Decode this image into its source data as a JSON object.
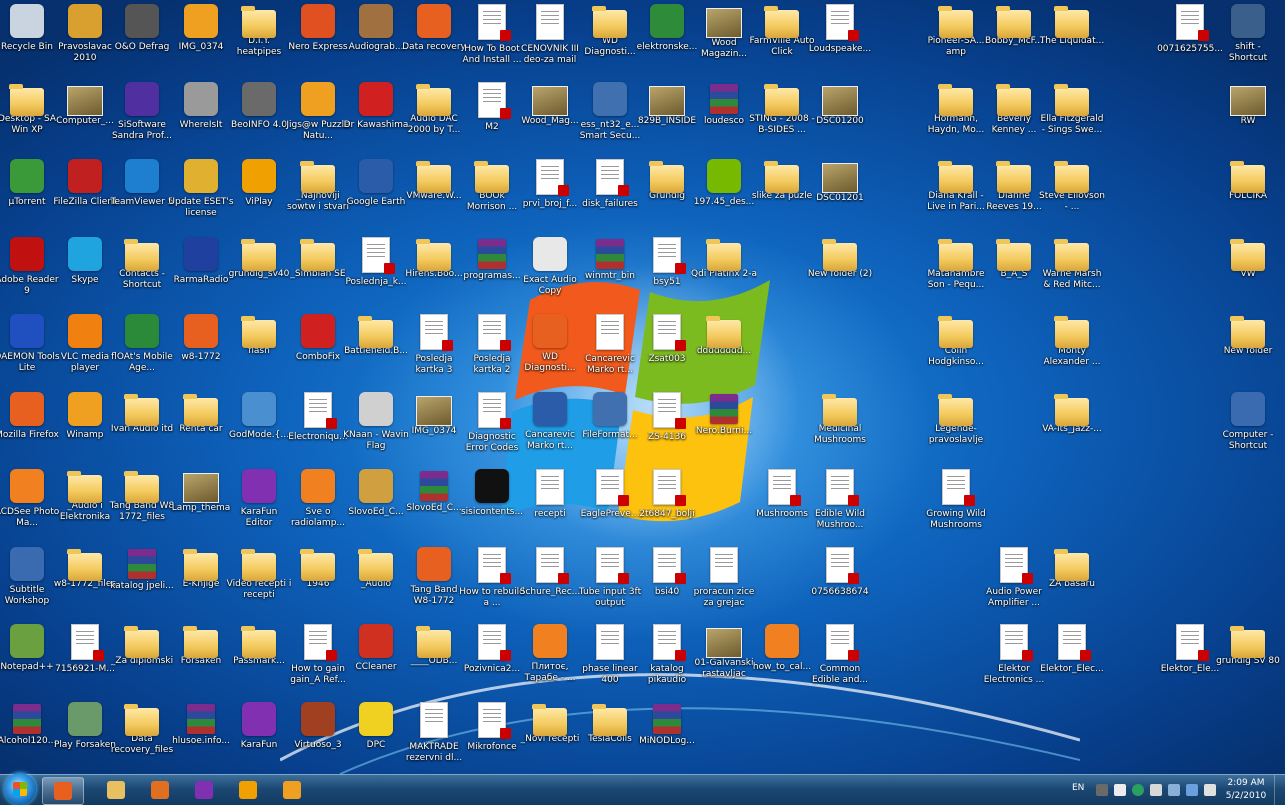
{
  "desktop": {
    "wallpaper": "windows-7-default",
    "icons": [
      {
        "label": "Recycle Bin",
        "type": "app",
        "icon": "recycle-bin-icon",
        "color": "#c9d4e0"
      },
      {
        "label": "Pravoslavac 2010",
        "type": "app",
        "icon": "cross-icon",
        "color": "#d9a030"
      },
      {
        "label": "O&O Defrag",
        "type": "app",
        "icon": "defrag-icon",
        "color": "#555555"
      },
      {
        "label": "IMG_0374",
        "type": "app",
        "icon": "image-icon",
        "color": "#f0a020"
      },
      {
        "label": "D.I.Y. heatpipes",
        "type": "folder"
      },
      {
        "label": "Nero Express",
        "type": "app",
        "icon": "nero-icon",
        "color": "#e05020"
      },
      {
        "label": "Audiograb...",
        "type": "app",
        "icon": "audiograbber-icon",
        "color": "#a07040"
      },
      {
        "label": "Data recovery",
        "type": "app",
        "icon": "firefox-document-icon",
        "color": "#e86020"
      },
      {
        "label": "How To Boot And Install ...",
        "type": "pdf"
      },
      {
        "label": "CENOVNIK III deo-za mail",
        "type": "doc"
      },
      {
        "label": "WD Diagnosti...",
        "type": "folder"
      },
      {
        "label": "elektronske...",
        "type": "app",
        "icon": "excel-icon",
        "color": "#2e8b3a"
      },
      {
        "label": "Wood Magazin...",
        "type": "image"
      },
      {
        "label": "FarmVille Auto Click",
        "type": "folder"
      },
      {
        "label": "Loudspeake...",
        "type": "pdf"
      },
      {
        "label": "Pioneer-SA... amp",
        "type": "folder"
      },
      {
        "label": "Bobby_McF...",
        "type": "folder"
      },
      {
        "label": "The Liquidat...",
        "type": "folder"
      },
      {
        "label": "0071625755...",
        "type": "pdf"
      },
      {
        "label": "shift - Shortcut",
        "type": "app",
        "icon": "shortcut-icon",
        "color": "#3a5f8a"
      },
      {
        "label": "Desktop - SA Win XP",
        "type": "folder"
      },
      {
        "label": "Computer_...",
        "type": "image"
      },
      {
        "label": "SiSoftware Sandra Prof...",
        "type": "app",
        "icon": "sisoftware-icon",
        "color": "#5030a0"
      },
      {
        "label": "WhereIsIt",
        "type": "app",
        "icon": "disc-icon",
        "color": "#9a9a9a"
      },
      {
        "label": "BeoINFO 4.0",
        "type": "app",
        "icon": "magnifier-icon",
        "color": "#6a6a6a"
      },
      {
        "label": "Jigs@w Puzzle Natu...",
        "type": "app",
        "icon": "puzzle-icon",
        "color": "#f0a020"
      },
      {
        "label": "Dr Kawashima",
        "type": "app",
        "icon": "robot-icon",
        "color": "#d02020"
      },
      {
        "label": "Audio DAC 2000 by T...",
        "type": "folder"
      },
      {
        "label": "M2",
        "type": "pdf"
      },
      {
        "label": "Wood_Mag...",
        "type": "image"
      },
      {
        "label": "ess_nt32_e... Smart Secu...",
        "type": "app",
        "icon": "installer-icon",
        "color": "#4070b0"
      },
      {
        "label": "829B_INSIDE",
        "type": "image"
      },
      {
        "label": "loudesco",
        "type": "rar"
      },
      {
        "label": "STING - 2008 - B-SIDES ...",
        "type": "folder"
      },
      {
        "label": "DSC01200",
        "type": "image"
      },
      {
        "label": "Hofmann, Haydn, Mo...",
        "type": "folder"
      },
      {
        "label": "Beverly Kenney ...",
        "type": "folder"
      },
      {
        "label": "Ella Fitzgerald - Sings Swe...",
        "type": "folder"
      },
      {
        "label": "RW",
        "type": "image"
      },
      {
        "label": "µTorrent",
        "type": "app",
        "icon": "utorrent-icon",
        "color": "#3a9a3a"
      },
      {
        "label": "FileZilla Client",
        "type": "app",
        "icon": "filezilla-icon",
        "color": "#c02020"
      },
      {
        "label": "TeamViewer 5",
        "type": "app",
        "icon": "teamviewer-icon",
        "color": "#1e7fd0"
      },
      {
        "label": "Update ESET's license",
        "type": "app",
        "icon": "update-icon",
        "color": "#e0b030"
      },
      {
        "label": "ViPlay",
        "type": "app",
        "icon": "viplay-icon",
        "color": "#f0a000"
      },
      {
        "label": "_Najnoviji sowtw i stvari",
        "type": "folder"
      },
      {
        "label": "Google Earth",
        "type": "app",
        "icon": "google-earth-icon",
        "color": "#2a5caa"
      },
      {
        "label": "VMware.W...",
        "type": "folder"
      },
      {
        "label": "BOOk Morrison ...",
        "type": "folder"
      },
      {
        "label": "prvi_broj_f...",
        "type": "pdf"
      },
      {
        "label": "disk_failures",
        "type": "pdf"
      },
      {
        "label": "Grundig",
        "type": "folder"
      },
      {
        "label": "197.45_des...",
        "type": "app",
        "icon": "nvidia-icon",
        "color": "#76b900"
      },
      {
        "label": "slike za puzle",
        "type": "folder"
      },
      {
        "label": "DSC01201",
        "type": "image"
      },
      {
        "label": "Diana Krall - Live in Pari...",
        "type": "folder"
      },
      {
        "label": "Dianne Reeves 19...",
        "type": "folder"
      },
      {
        "label": "Steve Eliovson - ...",
        "type": "folder"
      },
      {
        "label": "FOLCIKA",
        "type": "folder"
      },
      {
        "label": "Adobe Reader 9",
        "type": "app",
        "icon": "adobe-reader-icon",
        "color": "#c01010"
      },
      {
        "label": "Skype",
        "type": "app",
        "icon": "skype-icon",
        "color": "#1fa4e0"
      },
      {
        "label": "Contacts - Shortcut",
        "type": "folder"
      },
      {
        "label": "RarmaRadio",
        "type": "app",
        "icon": "radio-icon",
        "color": "#2040a0"
      },
      {
        "label": "grundig_sv40",
        "type": "folder"
      },
      {
        "label": "_Simbian SE",
        "type": "folder"
      },
      {
        "label": "Poslednja_k...",
        "type": "pdf"
      },
      {
        "label": "Hirens.Boo...",
        "type": "folder"
      },
      {
        "label": "programas...",
        "type": "rar"
      },
      {
        "label": "Exact Audio Copy",
        "type": "app",
        "icon": "eac-icon",
        "color": "#e8e8e8"
      },
      {
        "label": "winmtr_bin",
        "type": "rar"
      },
      {
        "label": "bsy51",
        "type": "pdf"
      },
      {
        "label": "Qdi Platinx 2-a",
        "type": "folder"
      },
      {
        "label": "New folder (2)",
        "type": "folder"
      },
      {
        "label": "Matahambre Son - Pequ...",
        "type": "folder"
      },
      {
        "label": "B_A_S",
        "type": "folder"
      },
      {
        "label": "Warne Marsh & Red Mitc...",
        "type": "folder"
      },
      {
        "label": "VW",
        "type": "folder"
      },
      {
        "label": "DAEMON Tools Lite",
        "type": "app",
        "icon": "daemon-icon",
        "color": "#2050c0"
      },
      {
        "label": "VLC media player",
        "type": "app",
        "icon": "vlc-icon",
        "color": "#f08010"
      },
      {
        "label": "flOAt's Mobile Age...",
        "type": "app",
        "icon": "mobile-agent-icon",
        "color": "#2a8a3a"
      },
      {
        "label": "w8-1772",
        "type": "app",
        "icon": "firefox-document-icon",
        "color": "#e86020"
      },
      {
        "label": "flash",
        "type": "folder"
      },
      {
        "label": "ComboFix",
        "type": "app",
        "icon": "combofix-icon",
        "color": "#d02020"
      },
      {
        "label": "Battlefield.B...",
        "type": "folder"
      },
      {
        "label": "Posledja kartka 3",
        "type": "pdf"
      },
      {
        "label": "Posledja kartka 2",
        "type": "pdf"
      },
      {
        "label": "WD Diagnosti...",
        "type": "app",
        "icon": "firefox-document-icon",
        "color": "#e86020"
      },
      {
        "label": "Cancarevic Marko rt...",
        "type": "doc"
      },
      {
        "label": "Zsat003",
        "type": "pdf"
      },
      {
        "label": "dddddddd...",
        "type": "folder"
      },
      {
        "label": "Colin Hodgkinso...",
        "type": "folder"
      },
      {
        "label": "Monty Alexander ...",
        "type": "folder"
      },
      {
        "label": "New folder",
        "type": "folder"
      },
      {
        "label": "Mozilla Firefox",
        "type": "app",
        "icon": "firefox-icon",
        "color": "#e86020"
      },
      {
        "label": "Winamp",
        "type": "app",
        "icon": "winamp-icon",
        "color": "#f0a020"
      },
      {
        "label": "Ivan Audio itd",
        "type": "folder"
      },
      {
        "label": "Renta car",
        "type": "folder"
      },
      {
        "label": "GodMode.{...",
        "type": "app",
        "icon": "control-panel-icon",
        "color": "#4a90d0"
      },
      {
        "label": "Electroniqu...",
        "type": "pdf"
      },
      {
        "label": "KNaan - Wavin Flag",
        "type": "app",
        "icon": "music-file-icon",
        "color": "#d0d0d0"
      },
      {
        "label": "IMG_0374",
        "type": "image"
      },
      {
        "label": "Diagnostic Error Codes",
        "type": "pdf"
      },
      {
        "label": "Cancarevic Marko rt...",
        "type": "app",
        "icon": "word-icon",
        "color": "#2a5caa"
      },
      {
        "label": "FileFormat...",
        "type": "app",
        "icon": "installer-icon",
        "color": "#4070b0"
      },
      {
        "label": "ZS-4136",
        "type": "pdf"
      },
      {
        "label": "Nero.Burni...",
        "type": "rar"
      },
      {
        "label": "Medicinal Mushrooms",
        "type": "folder"
      },
      {
        "label": "Legende-pravoslavlje",
        "type": "folder"
      },
      {
        "label": "VA-Its_Jazz-...",
        "type": "folder"
      },
      {
        "label": "Computer - Shortcut",
        "type": "app",
        "icon": "computer-icon",
        "color": "#3a6ab0"
      },
      {
        "label": "ACDSee Photo Ma...",
        "type": "app",
        "icon": "acdsee-icon",
        "color": "#f08020"
      },
      {
        "label": "_Audio i Elektronika",
        "type": "folder"
      },
      {
        "label": "Tang Band W8 1772_files",
        "type": "folder"
      },
      {
        "label": "Lamp_thema",
        "type": "image"
      },
      {
        "label": "KaraFun Editor",
        "type": "app",
        "icon": "karafun-icon",
        "color": "#8030b0"
      },
      {
        "label": "Sve o radiolamp...",
        "type": "app",
        "icon": "djvu-icon",
        "color": "#f08020"
      },
      {
        "label": "SlovoEd_C...",
        "type": "app",
        "icon": "slovoed-icon",
        "color": "#d0a040"
      },
      {
        "label": "SlovoEd_C...",
        "type": "rar"
      },
      {
        "label": "sisicontents...",
        "type": "app",
        "icon": "7zip-icon",
        "color": "#111111"
      },
      {
        "label": "recepti",
        "type": "doc"
      },
      {
        "label": "EaglePreve...",
        "type": "pdf"
      },
      {
        "label": "2t6847_bolji",
        "type": "pdf"
      },
      {
        "label": "Mushrooms",
        "type": "pdf"
      },
      {
        "label": "Edible Wild Mushroo...",
        "type": "pdf"
      },
      {
        "label": "Growing Wild Mushrooms",
        "type": "pdf"
      },
      {
        "label": "Subtitle Workshop",
        "type": "app",
        "icon": "subtitle-icon",
        "color": "#3a6ab0"
      },
      {
        "label": "w8-1772_files",
        "type": "folder"
      },
      {
        "label": "katalog jpeli...",
        "type": "rar"
      },
      {
        "label": "E-Knjige",
        "type": "folder"
      },
      {
        "label": "Video recepti i recepti",
        "type": "folder"
      },
      {
        "label": "1946",
        "type": "folder"
      },
      {
        "label": "_Audio",
        "type": "folder"
      },
      {
        "label": "Tang Band W8-1772",
        "type": "app",
        "icon": "firefox-document-icon",
        "color": "#e86020"
      },
      {
        "label": "How to rebuild a ...",
        "type": "pdf"
      },
      {
        "label": "Schure_Rec...",
        "type": "pdf"
      },
      {
        "label": "Tube input 3ft output",
        "type": "pdf"
      },
      {
        "label": "bsi40",
        "type": "pdf"
      },
      {
        "label": "proracun zice za grejac",
        "type": "doc"
      },
      {
        "label": "0756638674",
        "type": "pdf"
      },
      {
        "label": "Audio Power Amplifier ...",
        "type": "pdf"
      },
      {
        "label": "ZA basaru",
        "type": "folder"
      },
      {
        "label": "Notepad++",
        "type": "app",
        "icon": "notepad-plus-icon",
        "color": "#6aa040"
      },
      {
        "label": "7156921-M...",
        "type": "pdf"
      },
      {
        "label": "_Za diplomski",
        "type": "folder"
      },
      {
        "label": "Forsaken",
        "type": "folder"
      },
      {
        "label": "Passmark...",
        "type": "folder"
      },
      {
        "label": "How to gain gain_A Ref...",
        "type": "pdf"
      },
      {
        "label": "CCleaner",
        "type": "app",
        "icon": "ccleaner-icon",
        "color": "#d03020"
      },
      {
        "label": "____ODB...",
        "type": "folder"
      },
      {
        "label": "Pozivnica2...",
        "type": "pdf"
      },
      {
        "label": "Плитоє, Тарабе - ...",
        "type": "app",
        "icon": "djvu-icon",
        "color": "#f08020"
      },
      {
        "label": "phase linear 400",
        "type": "doc"
      },
      {
        "label": "katalog pikaudio",
        "type": "pdf"
      },
      {
        "label": "01-Galvanski rastavljac",
        "type": "image"
      },
      {
        "label": "how_to_cal...",
        "type": "app",
        "icon": "djvu-icon",
        "color": "#f08020"
      },
      {
        "label": "Common Edible and...",
        "type": "pdf"
      },
      {
        "label": "Elektor Electronics ...",
        "type": "pdf"
      },
      {
        "label": "Elektor_Elec...",
        "type": "pdf"
      },
      {
        "label": "Elektor_Ele...",
        "type": "pdf"
      },
      {
        "label": "grundig SV 80",
        "type": "folder"
      },
      {
        "label": "Alcohol120...",
        "type": "rar"
      },
      {
        "label": "Play Forsaken",
        "type": "app",
        "icon": "forsaken-icon",
        "color": "#6a9a6a"
      },
      {
        "label": "Data recovery_files",
        "type": "folder"
      },
      {
        "label": "hlusoe.info...",
        "type": "rar"
      },
      {
        "label": "KaraFun",
        "type": "app",
        "icon": "karafun-icon",
        "color": "#8030b0"
      },
      {
        "label": "Virtuoso_3",
        "type": "app",
        "icon": "book-icon",
        "color": "#a04020"
      },
      {
        "label": "DPC",
        "type": "app",
        "icon": "dpc-icon",
        "color": "#f0d020"
      },
      {
        "label": "MAKTRADE rezervni dl...",
        "type": "doc"
      },
      {
        "label": "Mikrofonce",
        "type": "pdf"
      },
      {
        "label": "_Novi recepti",
        "type": "folder"
      },
      {
        "label": "TeslaCoils",
        "type": "folder"
      },
      {
        "label": "MiNODLog...",
        "type": "rar"
      }
    ]
  },
  "taskbar": {
    "start_label": "Start",
    "pinned": [
      {
        "icon": "firefox-icon",
        "color": "#e86020",
        "active": true
      },
      {
        "icon": "explorer-icon",
        "color": "#e8c060",
        "active": false
      },
      {
        "icon": "media-player-icon",
        "color": "#e07020",
        "active": false
      },
      {
        "icon": "karafun-icon",
        "color": "#8030b0",
        "active": false
      },
      {
        "icon": "viplay-icon",
        "color": "#f0a000",
        "active": false
      },
      {
        "icon": "puzzle-icon",
        "color": "#f0a020",
        "active": false
      }
    ],
    "language": "EN",
    "time": "2:09 AM",
    "date": "5/2/2010"
  }
}
